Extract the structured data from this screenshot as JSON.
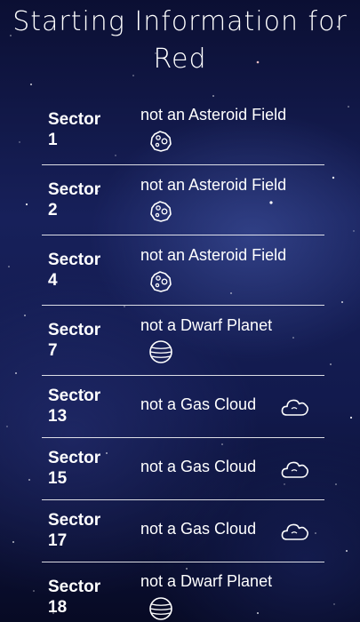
{
  "header": {
    "title": "Starting Information for Red"
  },
  "rows": [
    {
      "sector_label": "Sector",
      "sector_number": "1",
      "info": "not an Asteroid Field",
      "icon": "asteroid-icon"
    },
    {
      "sector_label": "Sector",
      "sector_number": "2",
      "info": "not an Asteroid Field",
      "icon": "asteroid-icon"
    },
    {
      "sector_label": "Sector",
      "sector_number": "4",
      "info": "not an Asteroid Field",
      "icon": "asteroid-icon"
    },
    {
      "sector_label": "Sector",
      "sector_number": "7",
      "info": "not a Dwarf Planet",
      "icon": "dwarf-planet-icon"
    },
    {
      "sector_label": "Sector",
      "sector_number": "13",
      "info": "not a Gas Cloud",
      "icon": "gas-cloud-icon"
    },
    {
      "sector_label": "Sector",
      "sector_number": "15",
      "info": "not a Gas Cloud",
      "icon": "gas-cloud-icon"
    },
    {
      "sector_label": "Sector",
      "sector_number": "17",
      "info": "not a Gas Cloud",
      "icon": "gas-cloud-icon"
    },
    {
      "sector_label": "Sector",
      "sector_number": "18",
      "info": "not a Dwarf Planet",
      "icon": "dwarf-planet-icon"
    }
  ],
  "colors": {
    "text": "#ffffff",
    "divider": "#ffffff",
    "background_dark": "#0b0f33",
    "background_mid": "#17205a"
  }
}
